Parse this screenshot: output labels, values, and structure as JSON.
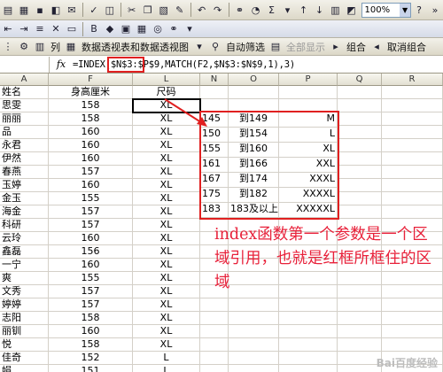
{
  "toolbar": {
    "zoom_value": "100%",
    "sigma": "Σ",
    "pivot_label": "数据透视表和数据透视图",
    "col_label": "列",
    "autofilter_label": "自动筛选",
    "show_all_label": "全部显示",
    "group_label": "组合",
    "ungroup_label": "取消组合"
  },
  "formula_bar": {
    "fx": "fx",
    "formula": "=INDEX($N$3:$P$9,MATCH(F2,$N$3:$N$9,1),3)"
  },
  "columns": {
    "A": "A",
    "F": "F",
    "L": "L",
    "N": "N",
    "O": "O",
    "P": "P",
    "Q": "Q",
    "R": "R"
  },
  "header_row": {
    "name": "姓名",
    "height": "身高厘米",
    "size": "尺码"
  },
  "rows": [
    {
      "name": "思雯",
      "height": "158",
      "size": "XL"
    },
    {
      "name": "丽丽",
      "height": "158",
      "size": "XL"
    },
    {
      "name": "品",
      "height": "160",
      "size": "XL"
    },
    {
      "name": "永君",
      "height": "160",
      "size": "XL"
    },
    {
      "name": "伊然",
      "height": "160",
      "size": "XL"
    },
    {
      "name": "春燕",
      "height": "157",
      "size": "XL"
    },
    {
      "name": "玉婷",
      "height": "160",
      "size": "XL"
    },
    {
      "name": "金玉",
      "height": "155",
      "size": "XL"
    },
    {
      "name": "海金",
      "height": "157",
      "size": "XL"
    },
    {
      "name": "科研",
      "height": "157",
      "size": "XL"
    },
    {
      "name": "云玲",
      "height": "160",
      "size": "XL"
    },
    {
      "name": "鑫磊",
      "height": "156",
      "size": "XL"
    },
    {
      "name": "一宁",
      "height": "160",
      "size": "XL"
    },
    {
      "name": "爽",
      "height": "155",
      "size": "XL"
    },
    {
      "name": "文秀",
      "height": "157",
      "size": "XL"
    },
    {
      "name": "婷婷",
      "height": "157",
      "size": "XL"
    },
    {
      "name": "志阳",
      "height": "158",
      "size": "XL"
    },
    {
      "name": "丽钏",
      "height": "160",
      "size": "XL"
    },
    {
      "name": "悦",
      "height": "158",
      "size": "XL"
    },
    {
      "name": "佳奇",
      "height": "152",
      "size": "L"
    },
    {
      "name": "娟",
      "height": "151",
      "size": "L"
    }
  ],
  "lookup_table": [
    {
      "n": "145",
      "o": "到149",
      "p": "M"
    },
    {
      "n": "150",
      "o": "到154",
      "p": "L"
    },
    {
      "n": "155",
      "o": "到160",
      "p": "XL"
    },
    {
      "n": "161",
      "o": "到166",
      "p": "XXL"
    },
    {
      "n": "167",
      "o": "到174",
      "p": "XXXL"
    },
    {
      "n": "175",
      "o": "到182",
      "p": "XXXXL"
    },
    {
      "n": "183",
      "o": "183及以上",
      "p": "XXXXXL"
    }
  ],
  "annotation": "index函数第一个参数是一个区域引用，也就是红框所框住的区域",
  "watermark": "Bai百度经验",
  "colors": {
    "red": "#e02020",
    "annotation": "#e8213a"
  }
}
